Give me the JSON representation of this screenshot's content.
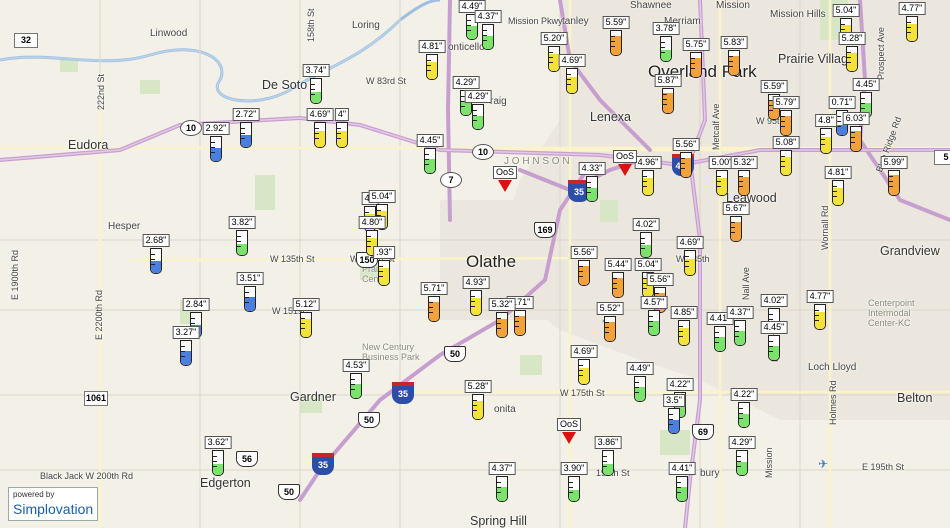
{
  "map": {
    "places": [
      {
        "id": "eudora",
        "text": "Eudora",
        "cls": "med"
      },
      {
        "id": "linwood",
        "text": "Linwood",
        "cls": "sm"
      },
      {
        "id": "loring",
        "text": "Loring",
        "cls": "sm"
      },
      {
        "id": "desoto",
        "text": "De Soto",
        "cls": "med"
      },
      {
        "id": "lenexa",
        "text": "Lenexa",
        "cls": "med"
      },
      {
        "id": "overland",
        "text": "Overland Park",
        "cls": "big"
      },
      {
        "id": "prairievillage",
        "text": "Prairie Village",
        "cls": "med"
      },
      {
        "id": "olathe",
        "text": "Olathe",
        "cls": "big"
      },
      {
        "id": "leawood",
        "text": "Leawood",
        "cls": "med"
      },
      {
        "id": "grandview",
        "text": "Grandview",
        "cls": "med"
      },
      {
        "id": "hesper",
        "text": "Hesper",
        "cls": "sm"
      },
      {
        "id": "gardner",
        "text": "Gardner",
        "cls": "med"
      },
      {
        "id": "edgerton",
        "text": "Edgerton",
        "cls": "med"
      },
      {
        "id": "springhill",
        "text": "Spring Hill",
        "cls": "med"
      },
      {
        "id": "belton",
        "text": "Belton",
        "cls": "med"
      },
      {
        "id": "lochlloyd",
        "text": "Loch Lloyd",
        "cls": "sm"
      },
      {
        "id": "missionhills",
        "text": "Mission Hills",
        "cls": "sm"
      },
      {
        "id": "prairiecenter",
        "text": "Prairie Center",
        "cls": "sm gray"
      },
      {
        "id": "newcentury",
        "text": "New Century Business Park",
        "cls": "sm gray"
      },
      {
        "id": "centerpoint",
        "text": "Centerpoint Intermodal Center-KC",
        "cls": "sm gray"
      },
      {
        "id": "johnson",
        "text": "J O H N S O N",
        "cls": "sm gray"
      },
      {
        "id": "merriam",
        "text": "Merriam",
        "cls": "sm"
      },
      {
        "id": "shawnee",
        "text": "Shawnee",
        "cls": "sm"
      },
      {
        "id": "mission",
        "text": "Mission",
        "cls": "sm"
      },
      {
        "id": "monticello",
        "text": "onticello",
        "cls": "sm"
      },
      {
        "id": "craig",
        "text": "raig",
        "cls": "sm"
      },
      {
        "id": "stanley",
        "text": "tanley",
        "cls": "sm"
      },
      {
        "id": "bucyrus",
        "text": "bury",
        "cls": "sm"
      },
      {
        "id": "spring",
        "text": "onita",
        "cls": "sm"
      }
    ],
    "roads": [
      {
        "id": "r-83rd",
        "text": "W 83rd St"
      },
      {
        "id": "r-95th",
        "text": "W 95th"
      },
      {
        "id": "r-135th",
        "text": "W 135th St"
      },
      {
        "id": "r-135th-2",
        "text": "W 135th St"
      },
      {
        "id": "r-135th-3",
        "text": "W 135th"
      },
      {
        "id": "r-151st",
        "text": "W 151st"
      },
      {
        "id": "r-175th",
        "text": "W 175th St"
      },
      {
        "id": "r-199th",
        "text": "199th St"
      },
      {
        "id": "r-200th",
        "text": "Black Jack W 200th Rd"
      },
      {
        "id": "r-195th",
        "text": "E 195th St"
      },
      {
        "id": "r-mission",
        "text": "Mission Pkwy"
      },
      {
        "id": "r-222nd",
        "text": "222nd St"
      },
      {
        "id": "r-158th",
        "text": "158th St"
      },
      {
        "id": "r-1900",
        "text": "E 1900th Rd"
      },
      {
        "id": "r-2200",
        "text": "E 2200th Rd"
      },
      {
        "id": "r-metcalf",
        "text": "Metcalf Ave"
      },
      {
        "id": "r-nall",
        "text": "Nall Ave"
      },
      {
        "id": "r-wornall",
        "text": "Wornall Rd"
      },
      {
        "id": "r-holmes",
        "text": "Holmes Rd"
      },
      {
        "id": "r-mission-rd",
        "text": "Mission Rd"
      },
      {
        "id": "r-mission-rd2",
        "text": "Mission"
      },
      {
        "id": "r-blueridge",
        "text": "Blue Ridge Rd"
      },
      {
        "id": "r-prospect",
        "text": "Prospect Ave"
      }
    ],
    "shields": [
      {
        "text": "32",
        "type": "co"
      },
      {
        "text": "10",
        "type": "ks"
      },
      {
        "text": "10",
        "type": "ks"
      },
      {
        "text": "7",
        "type": "ks"
      },
      {
        "text": "35",
        "type": "i"
      },
      {
        "text": "169",
        "type": "us"
      },
      {
        "text": "435",
        "type": "i"
      },
      {
        "text": "150",
        "type": "us"
      },
      {
        "text": "50",
        "type": "us"
      },
      {
        "text": "35",
        "type": "i"
      },
      {
        "text": "50",
        "type": "us"
      },
      {
        "text": "56",
        "type": "us"
      },
      {
        "text": "50",
        "type": "us"
      },
      {
        "text": "35",
        "type": "i"
      },
      {
        "text": "1061",
        "type": "co"
      },
      {
        "text": "69",
        "type": "us"
      },
      {
        "text": "5",
        "type": "co"
      }
    ],
    "gauges": [
      {
        "v": "4.49\"",
        "c": "#7be26b",
        "f": 0.55
      },
      {
        "v": "4.37\"",
        "c": "#7be26b",
        "f": 0.55
      },
      {
        "v": "4.81\"",
        "c": "#f3e23a",
        "f": 0.7
      },
      {
        "v": "5.59\"",
        "c": "#f3a13a",
        "f": 0.8
      },
      {
        "v": "3.78\"",
        "c": "#7be26b",
        "f": 0.45
      },
      {
        "v": "5.20\"",
        "c": "#f3e23a",
        "f": 0.7
      },
      {
        "v": "4.69\"",
        "c": "#f3e23a",
        "f": 0.65
      },
      {
        "v": "5.75\"",
        "c": "#f3a13a",
        "f": 0.8
      },
      {
        "v": "5.83\"",
        "c": "#f3a13a",
        "f": 0.8
      },
      {
        "v": "5.04\"",
        "c": "#f3e23a",
        "f": 0.75
      },
      {
        "v": "4.77\"",
        "c": "#f3e23a",
        "f": 0.7
      },
      {
        "v": "5.28\"",
        "c": "#f3e23a",
        "f": 0.75
      },
      {
        "v": "3.74\"",
        "c": "#7be26b",
        "f": 0.45
      },
      {
        "v": "4.29\"",
        "c": "#7be26b",
        "f": 0.55
      },
      {
        "v": "4.29\"",
        "c": "#7be26b",
        "f": 0.55
      },
      {
        "v": "5.87\"",
        "c": "#f3a13a",
        "f": 0.85
      },
      {
        "v": "5.59\"",
        "c": "#f3a13a",
        "f": 0.8
      },
      {
        "v": "5.79\"",
        "c": "#f3a13a",
        "f": 0.8
      },
      {
        "v": "4.45\"",
        "c": "#7be26b",
        "f": 0.6
      },
      {
        "v": "0.71\"",
        "c": "#4a7fe0",
        "f": 0.4
      },
      {
        "v": "2.72\"",
        "c": "#4a7fe0",
        "f": 0.5
      },
      {
        "v": "2.92\"",
        "c": "#4a7fe0",
        "f": 0.55
      },
      {
        "v": "4.69\"",
        "c": "#f3e23a",
        "f": 0.65
      },
      {
        "v": "4\"",
        "c": "#f3e23a",
        "f": 0.65
      },
      {
        "v": "4.8\"",
        "c": "#f3e23a",
        "f": 0.65
      },
      {
        "v": "6.03\"",
        "c": "#f3a13a",
        "f": 0.85
      },
      {
        "v": "4.45\"",
        "c": "#7be26b",
        "f": 0.6
      },
      {
        "v": "5.56\"",
        "c": "#f3a13a",
        "f": 0.8
      },
      {
        "v": "5.08\"",
        "c": "#f3e23a",
        "f": 0.75
      },
      {
        "v": "4.33\"",
        "c": "#7be26b",
        "f": 0.55
      },
      {
        "v": "4.96\"",
        "c": "#f3e23a",
        "f": 0.7
      },
      {
        "v": "5.00\"",
        "c": "#f3e23a",
        "f": 0.7
      },
      {
        "v": "5.32\"",
        "c": "#f3a13a",
        "f": 0.75
      },
      {
        "v": "5.99\"",
        "c": "#f3a13a",
        "f": 0.85
      },
      {
        "v": "4.81\"",
        "c": "#f3e23a",
        "f": 0.7
      },
      {
        "v": "4.\"",
        "c": "#f3e23a",
        "f": 0.7
      },
      {
        "v": "5.04\"",
        "c": "#f3e23a",
        "f": 0.75
      },
      {
        "v": "4.80\"",
        "c": "#f3e23a",
        "f": 0.7
      },
      {
        "v": "3.82\"",
        "c": "#7be26b",
        "f": 0.45
      },
      {
        "v": "2.68\"",
        "c": "#4a7fe0",
        "f": 0.5
      },
      {
        "v": "5.67\"",
        "c": "#f3a13a",
        "f": 0.8
      },
      {
        "v": "4.02\"",
        "c": "#7be26b",
        "f": 0.5
      },
      {
        "v": "4.69\"",
        "c": "#f3e23a",
        "f": 0.65
      },
      {
        "v": ".93\"",
        "c": "#f3e23a",
        "f": 0.7
      },
      {
        "v": "3.51\"",
        "c": "#4a7fe0",
        "f": 0.6
      },
      {
        "v": "2.84\"",
        "c": "#4a7fe0",
        "f": 0.5
      },
      {
        "v": "5.12\"",
        "c": "#f3e23a",
        "f": 0.75
      },
      {
        "v": "5.71\"",
        "c": "#f3a13a",
        "f": 0.8
      },
      {
        "v": "4.93\"",
        "c": "#f3e23a",
        "f": 0.7
      },
      {
        "v": "5.71\"",
        "c": "#f3a13a",
        "f": 0.8
      },
      {
        "v": "5.32\"",
        "c": "#f3a13a",
        "f": 0.75
      },
      {
        "v": "5.56\"",
        "c": "#f3a13a",
        "f": 0.8
      },
      {
        "v": "5.44\"",
        "c": "#f3a13a",
        "f": 0.8
      },
      {
        "v": "5.04\"",
        "c": "#f3e23a",
        "f": 0.75
      },
      {
        "v": "5.56\"",
        "c": "#f3a13a",
        "f": 0.8
      },
      {
        "v": "4.77\"",
        "c": "#f3e23a",
        "f": 0.7
      },
      {
        "v": "3.27\"",
        "c": "#4a7fe0",
        "f": 0.6
      },
      {
        "v": "5.52\"",
        "c": "#f3a13a",
        "f": 0.8
      },
      {
        "v": "4.57\"",
        "c": "#7be26b",
        "f": 0.6
      },
      {
        "v": "4.85\"",
        "c": "#f3e23a",
        "f": 0.7
      },
      {
        "v": "4.41\"",
        "c": "#7be26b",
        "f": 0.6
      },
      {
        "v": "4.37\"",
        "c": "#7be26b",
        "f": 0.6
      },
      {
        "v": "4.02\"",
        "c": "#7be26b",
        "f": 0.5
      },
      {
        "v": "4.45\"",
        "c": "#7be26b",
        "f": 0.6
      },
      {
        "v": "4.53\"",
        "c": "#7be26b",
        "f": 0.6
      },
      {
        "v": "4.69\"",
        "c": "#f3e23a",
        "f": 0.65
      },
      {
        "v": "4.49\"",
        "c": "#7be26b",
        "f": 0.6
      },
      {
        "v": "5.28\"",
        "c": "#f3e23a",
        "f": 0.75
      },
      {
        "v": "4.22\"",
        "c": "#7be26b",
        "f": 0.55
      },
      {
        "v": "3.5\"",
        "c": "#4a7fe0",
        "f": 0.55
      },
      {
        "v": "4.22\"",
        "c": "#7be26b",
        "f": 0.55
      },
      {
        "v": "3.62\"",
        "c": "#7be26b",
        "f": 0.45
      },
      {
        "v": "3.86\"",
        "c": "#7be26b",
        "f": 0.45
      },
      {
        "v": "4.29\"",
        "c": "#7be26b",
        "f": 0.55
      },
      {
        "v": "4.37\"",
        "c": "#7be26b",
        "f": 0.6
      },
      {
        "v": "3.90\"",
        "c": "#7be26b",
        "f": 0.45
      },
      {
        "v": "4.41\"",
        "c": "#7be26b",
        "f": 0.6
      }
    ],
    "oos": [
      {
        "text": "OoS"
      },
      {
        "text": "OoS"
      },
      {
        "text": "OoS"
      }
    ],
    "brand": {
      "powered": "powered by",
      "name": "Simplovation"
    }
  }
}
